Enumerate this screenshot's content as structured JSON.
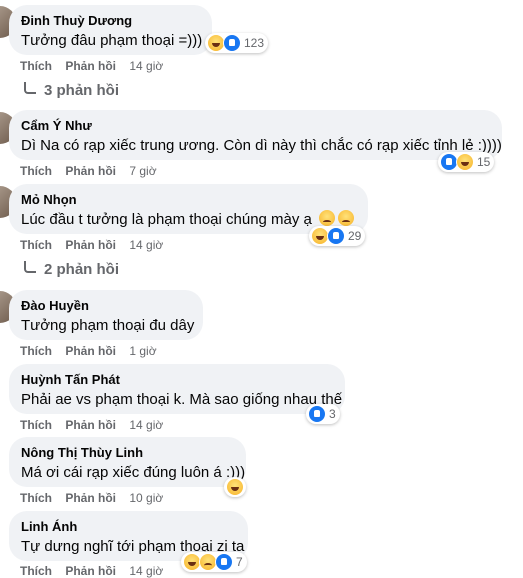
{
  "labels": {
    "like": "Thích",
    "reply": "Phản hồi"
  },
  "comments": [
    {
      "name": "Đinh Thuỳ Dương",
      "text": "Tưởng đâu phạm thoại =)))",
      "time": "14 giờ",
      "reaction_count": "123",
      "reactions": [
        "haha",
        "like"
      ]
    },
    {
      "name": "Cẩm Ý Như",
      "text": "Dì Na có rạp xiếc trung ương. Còn dì này thì chắc có rạp xiếc tỉnh lẻ :))))",
      "time": "7 giờ",
      "reaction_count": "15",
      "reactions": [
        "like",
        "haha"
      ]
    },
    {
      "name": "Mỏ Nhọn",
      "text": "Lúc đầu t tưởng là phạm thoại chúng mày ạ",
      "time": "14 giờ",
      "reaction_count": "29",
      "reactions": [
        "haha",
        "like"
      ]
    },
    {
      "name": "Đào Huyền",
      "text": "Tưởng phạm thoại đu dây",
      "time": "1 giờ",
      "reaction_count": "",
      "reactions": []
    },
    {
      "name": "Huỳnh Tấn Phát",
      "text": "Phải ae vs phạm thoại k. Mà sao giống nhau thế",
      "time": "14 giờ",
      "reaction_count": "3",
      "reactions": [
        "like"
      ]
    },
    {
      "name": "Nông Thị Thùy Linh",
      "text": "Má ơi cái rạp xiếc đúng luôn á :)))",
      "time": "10 giờ",
      "reaction_count": "",
      "reactions": [
        "haha"
      ]
    },
    {
      "name": "Linh Ánh",
      "text": "Tự dưng nghĩ tới phạm thoại zị ta",
      "time": "14 giờ",
      "reaction_count": "7",
      "reactions": [
        "haha",
        "sad",
        "like"
      ]
    }
  ],
  "replies": [
    {
      "label": "3 phản hồi"
    },
    {
      "label": "2 phản hồi"
    }
  ]
}
